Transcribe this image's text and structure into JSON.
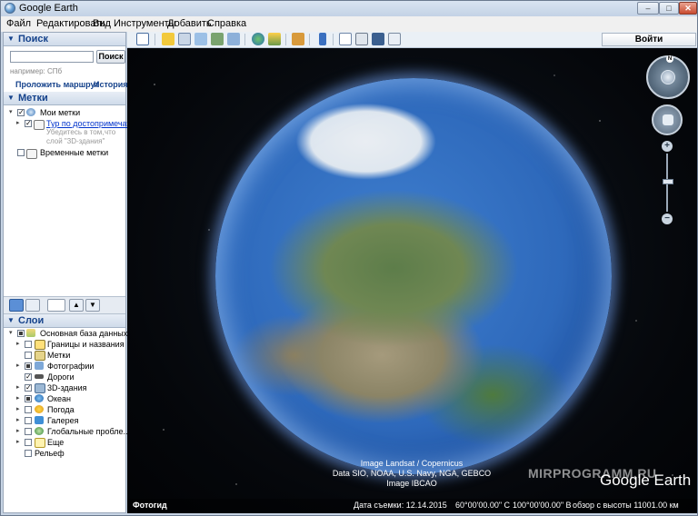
{
  "window": {
    "title": "Google Earth",
    "min_glyph": "–",
    "max_glyph": "□",
    "close_glyph": "✕"
  },
  "menu": [
    {
      "label": "Файл"
    },
    {
      "label": "Редактировать"
    },
    {
      "label": "Вид"
    },
    {
      "label": "Инструменты"
    },
    {
      "label": "Добавить"
    },
    {
      "label": "Справка"
    }
  ],
  "toolbar": {
    "login_label": "Войти",
    "icons": [
      "sidebar-toggle-icon",
      "placemark-icon",
      "polygon-icon",
      "path-icon",
      "image-overlay-icon",
      "record-tour-icon",
      "historical-imagery-icon",
      "sunlight-icon",
      "planets-icon",
      "ruler-icon",
      "email-icon",
      "print-icon",
      "save-image-icon",
      "view-in-maps-icon"
    ]
  },
  "search": {
    "header": "Поиск",
    "input_value": "",
    "button_label": "Поиск",
    "hint": "например: СПб",
    "route_link": "Проложить маршрут",
    "history_link": "История"
  },
  "places": {
    "header": "Метки",
    "my_places": "Мои метки",
    "tour_link": "Тур по достопримечат",
    "tour_note_1": "Убедитесь в том,",
    "tour_note_2": "что",
    "tour_note_3": "слой \"3D-здания\"",
    "temporary": "Временные метки"
  },
  "layers": {
    "header": "Слои",
    "primary_db": "Основная база данных",
    "items": [
      {
        "label": "Границы и названия",
        "checked": false,
        "expandable": true
      },
      {
        "label": "Метки",
        "checked": false,
        "expandable": false
      },
      {
        "label": "Фотографии",
        "checked": false,
        "partial": true,
        "expandable": true
      },
      {
        "label": "Дороги",
        "checked": true,
        "expandable": false
      },
      {
        "label": "3D-здания",
        "checked": true,
        "expandable": true
      },
      {
        "label": "Океан",
        "checked": false,
        "partial": true,
        "expandable": true
      },
      {
        "label": "Погода",
        "checked": false,
        "expandable": true
      },
      {
        "label": "Галерея",
        "checked": false,
        "expandable": true
      },
      {
        "label": "Глобальные пробле...",
        "checked": false,
        "expandable": true
      },
      {
        "label": "Еще",
        "checked": false,
        "expandable": true
      },
      {
        "label": "Рельеф",
        "checked": false,
        "expandable": false
      }
    ]
  },
  "map": {
    "watermark": "MIRPROGRAMM.RU",
    "logo": "Google Earth",
    "attribution_1": "Image Landsat / Copernicus",
    "attribution_2": "Data SIO, NOAA, U.S. Navy, NGA, GEBCO",
    "attribution_3": "Image IBCAO",
    "tour_guide": "Фотогид",
    "capture_date": "Дата съемки: 12.14.2015",
    "lat": "60°00'00.00\" С",
    "lon": "100°00'00.00\" В",
    "altitude": "обзор с высоты 11001.00 км",
    "north_label": "N",
    "zoom_in": "+",
    "zoom_out": "−"
  },
  "colors": {
    "accent": "#15428b",
    "link": "#0033cc",
    "window_bg": "#c7d4e4"
  }
}
